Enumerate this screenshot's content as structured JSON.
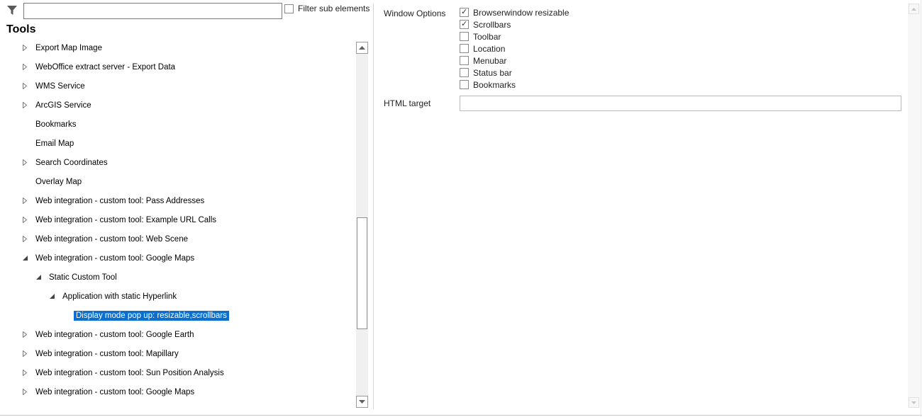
{
  "filter": {
    "value": "",
    "sub_elements_label": "Filter sub elements",
    "sub_elements_checked": false
  },
  "tools_title": "Tools",
  "tree": [
    {
      "label": "Export Map Image",
      "expander": "collapsed",
      "level": 0
    },
    {
      "label": "WebOffice extract server - Export Data",
      "expander": "collapsed",
      "level": 0
    },
    {
      "label": "WMS Service",
      "expander": "collapsed",
      "level": 0
    },
    {
      "label": "ArcGIS Service",
      "expander": "collapsed",
      "level": 0
    },
    {
      "label": "Bookmarks",
      "expander": "none",
      "level": 0
    },
    {
      "label": "Email Map",
      "expander": "none",
      "level": 0
    },
    {
      "label": "Search Coordinates",
      "expander": "collapsed",
      "level": 0
    },
    {
      "label": "Overlay Map",
      "expander": "none",
      "level": 0
    },
    {
      "label": "Web integration - custom tool: Pass Addresses",
      "expander": "collapsed",
      "level": 0
    },
    {
      "label": "Web integration - custom tool: Example URL Calls",
      "expander": "collapsed",
      "level": 0
    },
    {
      "label": "Web integration - custom tool: Web Scene",
      "expander": "collapsed",
      "level": 0
    },
    {
      "label": "Web integration - custom tool: Google Maps",
      "expander": "expanded",
      "level": 0
    },
    {
      "label": "Static Custom Tool",
      "expander": "expanded",
      "level": 1
    },
    {
      "label": "Application with static Hyperlink",
      "expander": "expanded",
      "level": 2
    },
    {
      "label": "Display mode pop up: resizable,scrollbars",
      "expander": "none",
      "level": 3,
      "selected": true
    },
    {
      "label": "Web integration - custom tool: Google Earth",
      "expander": "collapsed",
      "level": 0
    },
    {
      "label": "Web integration - custom tool: Mapillary",
      "expander": "collapsed",
      "level": 0
    },
    {
      "label": "Web integration - custom tool: Sun Position Analysis",
      "expander": "collapsed",
      "level": 0
    },
    {
      "label": "Web integration - custom tool: Google Maps",
      "expander": "collapsed",
      "level": 0
    }
  ],
  "window_options": {
    "label": "Window Options",
    "options": [
      {
        "label": "Browserwindow resizable",
        "checked": true
      },
      {
        "label": "Scrollbars",
        "checked": true
      },
      {
        "label": "Toolbar",
        "checked": false
      },
      {
        "label": "Location",
        "checked": false
      },
      {
        "label": "Menubar",
        "checked": false
      },
      {
        "label": "Status bar",
        "checked": false
      },
      {
        "label": "Bookmarks",
        "checked": false
      }
    ]
  },
  "html_target": {
    "label": "HTML target",
    "value": ""
  },
  "colors": {
    "selection_background": "#0a6fcf",
    "selection_text": "#ffffff"
  }
}
